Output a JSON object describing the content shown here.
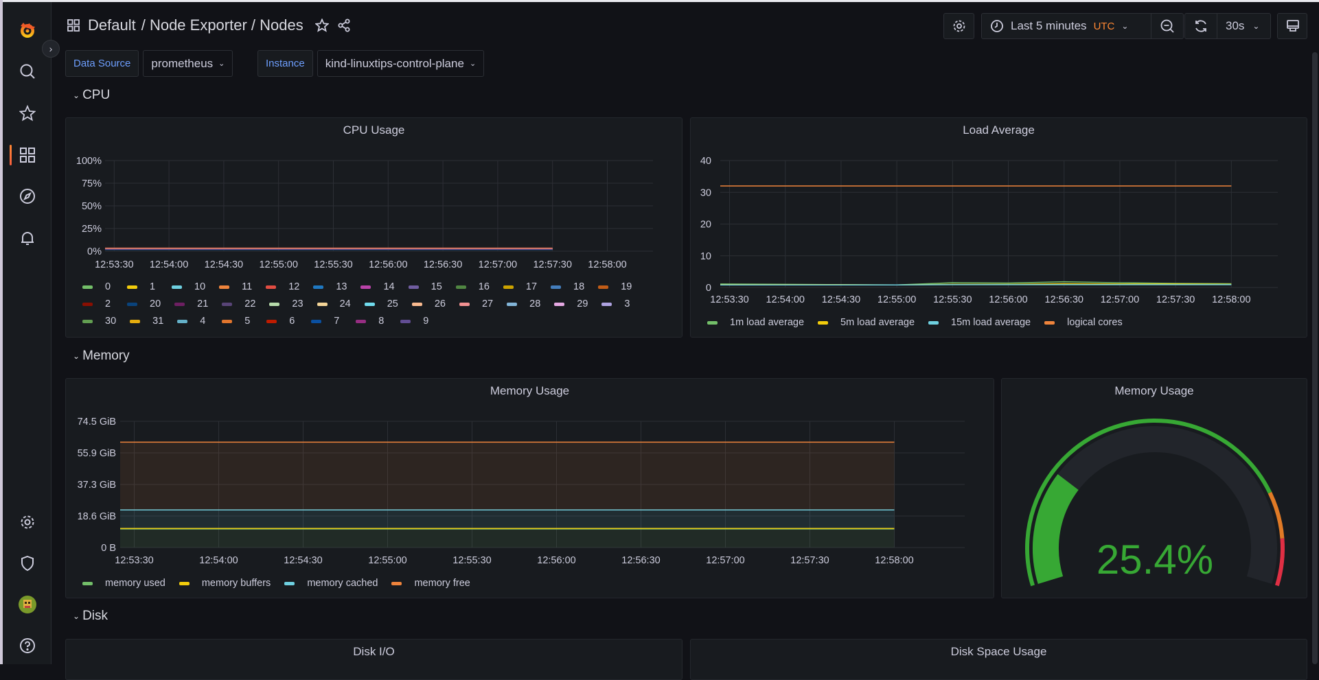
{
  "header": {
    "breadcrumb_folder": "Default",
    "breadcrumb_rest": "/ Node Exporter / Nodes"
  },
  "toolbar": {
    "time_range": "Last 5 minutes",
    "timezone": "UTC",
    "refresh_interval": "30s"
  },
  "variables": [
    {
      "label": "Data Source",
      "value": "prometheus"
    },
    {
      "label": "Instance",
      "value": "kind-linuxtips-control-plane"
    }
  ],
  "rows": {
    "cpu": "CPU",
    "memory": "Memory",
    "disk": "Disk"
  },
  "panels": {
    "cpu_usage": "CPU Usage",
    "load_average": "Load Average",
    "memory_usage": "Memory Usage",
    "memory_gauge": "Memory Usage",
    "disk_io": "Disk I/O",
    "disk_space": "Disk Space Usage"
  },
  "colors": {
    "accent": "#ff8833",
    "timezone": "#ff8833",
    "variable_label": "#6e9fff",
    "gauge_green": "#37a834",
    "gauge_orange": "#e07a26",
    "gauge_red": "#e02f44"
  },
  "chart_data": [
    {
      "type": "line",
      "id": "cpu",
      "xlim": [
        "12:53:25",
        "12:58:25"
      ],
      "xticks": [
        "12:53:30",
        "12:54:00",
        "12:54:30",
        "12:55:00",
        "12:55:30",
        "12:56:00",
        "12:56:30",
        "12:57:00",
        "12:57:30",
        "12:58:00"
      ],
      "yticks": [
        "100%",
        "75%",
        "50%",
        "25%",
        "0%"
      ],
      "ylim": [
        0,
        100
      ],
      "grid": true,
      "legend": "bottom",
      "x": [
        "12:53:25",
        "12:54:30",
        "12:55:30",
        "12:56:30",
        "12:57:30"
      ],
      "series": [
        {
          "name": "0",
          "color": "#73bf69",
          "values": [
            3,
            3,
            3,
            3,
            3
          ]
        },
        {
          "name": "1",
          "color": "#f2cc0c",
          "values": [
            2,
            2,
            2,
            2,
            2
          ]
        },
        {
          "name": "10",
          "color": "#6ed0e0",
          "values": [
            2.5,
            2.5,
            2.5,
            2.5,
            2.5
          ]
        },
        {
          "name": "11",
          "color": "#ef843c",
          "values": [
            2,
            2,
            2,
            2,
            2
          ]
        },
        {
          "name": "12",
          "color": "#e24d42",
          "values": [
            3.5,
            3.5,
            3.5,
            3.5,
            3.5
          ]
        },
        {
          "name": "13",
          "color": "#1f78c1",
          "values": [
            2,
            2,
            2,
            2,
            2
          ]
        },
        {
          "name": "14",
          "color": "#ba43a9",
          "values": [
            2.5,
            2.5,
            2.5,
            2.5,
            2.5
          ]
        },
        {
          "name": "15",
          "color": "#705da0",
          "values": [
            2,
            2,
            2,
            2,
            2
          ]
        },
        {
          "name": "16",
          "color": "#508642",
          "values": [
            1.5,
            1.5,
            1.5,
            1.5,
            1.5
          ]
        },
        {
          "name": "17",
          "color": "#cca300",
          "values": [
            2,
            2,
            2,
            2,
            2
          ]
        },
        {
          "name": "18",
          "color": "#447ebc",
          "values": [
            2,
            2,
            2,
            2,
            2
          ]
        },
        {
          "name": "19",
          "color": "#c15c17",
          "values": [
            2.5,
            2.5,
            2.5,
            2.5,
            2.5
          ]
        },
        {
          "name": "2",
          "color": "#890f02",
          "values": [
            2,
            2,
            2,
            2,
            2
          ]
        },
        {
          "name": "20",
          "color": "#0a437c",
          "values": [
            1.5,
            1.5,
            1.5,
            1.5,
            1.5
          ]
        },
        {
          "name": "21",
          "color": "#6d1f62",
          "values": [
            2,
            2,
            2,
            2,
            2
          ]
        },
        {
          "name": "22",
          "color": "#584477",
          "values": [
            2,
            2,
            2,
            2,
            2
          ]
        },
        {
          "name": "23",
          "color": "#b7dbab",
          "values": [
            2.5,
            2.5,
            2.5,
            2.5,
            2.5
          ]
        },
        {
          "name": "24",
          "color": "#f4d598",
          "values": [
            2,
            2,
            2,
            2,
            2
          ]
        },
        {
          "name": "25",
          "color": "#70dbed",
          "values": [
            2,
            2,
            2,
            2,
            2
          ]
        },
        {
          "name": "26",
          "color": "#f9ba8f",
          "values": [
            3,
            3,
            3,
            3,
            3
          ]
        },
        {
          "name": "27",
          "color": "#f29191",
          "values": [
            2,
            2,
            2,
            2,
            2
          ]
        },
        {
          "name": "28",
          "color": "#82b5d8",
          "values": [
            2,
            2,
            2,
            2,
            2
          ]
        },
        {
          "name": "29",
          "color": "#e5a8e2",
          "values": [
            2.5,
            2.5,
            2.5,
            2.5,
            2.5
          ]
        },
        {
          "name": "3",
          "color": "#aea2e0",
          "values": [
            2,
            2,
            2,
            2,
            2
          ]
        },
        {
          "name": "30",
          "color": "#629e51",
          "values": [
            2,
            2,
            2,
            2,
            2
          ]
        },
        {
          "name": "31",
          "color": "#e5ac0e",
          "values": [
            2,
            2,
            2,
            2,
            2
          ]
        },
        {
          "name": "4",
          "color": "#64b0c8",
          "values": [
            2,
            2,
            2,
            2,
            2
          ]
        },
        {
          "name": "5",
          "color": "#e0752d",
          "values": [
            2.5,
            2.5,
            2.5,
            2.5,
            2.5
          ]
        },
        {
          "name": "6",
          "color": "#bf1b00",
          "values": [
            2,
            2,
            2,
            2,
            2
          ]
        },
        {
          "name": "7",
          "color": "#0a50a1",
          "values": [
            2,
            2,
            2,
            2,
            2
          ]
        },
        {
          "name": "8",
          "color": "#962d82",
          "values": [
            2,
            2,
            2,
            2,
            2
          ]
        },
        {
          "name": "9",
          "color": "#614d93",
          "values": [
            2,
            2,
            2,
            2,
            2
          ]
        }
      ]
    },
    {
      "type": "line",
      "id": "load",
      "xlim": [
        "12:53:25",
        "12:58:25"
      ],
      "xticks": [
        "12:53:30",
        "12:54:00",
        "12:54:30",
        "12:55:00",
        "12:55:30",
        "12:56:00",
        "12:56:30",
        "12:57:00",
        "12:57:30",
        "12:58:00"
      ],
      "yticks": [
        "40",
        "30",
        "20",
        "10",
        "0"
      ],
      "ylim": [
        0,
        40
      ],
      "grid": true,
      "legend": "bottom",
      "x": [
        "12:53:25",
        "12:54:00",
        "12:54:30",
        "12:55:00",
        "12:55:30",
        "12:56:00",
        "12:56:30",
        "12:57:00",
        "12:57:30",
        "12:58:00"
      ],
      "series": [
        {
          "name": "1m load average",
          "color": "#73bf69",
          "values": [
            1.1,
            1.0,
            0.9,
            0.8,
            1.5,
            1.4,
            1.8,
            1.5,
            1.3,
            1.2
          ]
        },
        {
          "name": "5m load average",
          "color": "#f2cc0c",
          "values": [
            0.9,
            0.9,
            0.9,
            0.8,
            1.0,
            1.0,
            1.2,
            1.1,
            1.1,
            1.0
          ]
        },
        {
          "name": "15m load average",
          "color": "#6ed0e0",
          "values": [
            0.8,
            0.8,
            0.8,
            0.8,
            0.9,
            0.9,
            0.9,
            0.9,
            0.9,
            0.9
          ]
        },
        {
          "name": "logical cores",
          "color": "#ef843c",
          "values": [
            32,
            32,
            32,
            32,
            32,
            32,
            32,
            32,
            32,
            32
          ]
        }
      ]
    },
    {
      "type": "area",
      "id": "memory",
      "stacked": true,
      "xlim": [
        "12:53:25",
        "12:58:25"
      ],
      "xticks": [
        "12:53:30",
        "12:54:00",
        "12:54:30",
        "12:55:00",
        "12:55:30",
        "12:56:00",
        "12:56:30",
        "12:57:00",
        "12:57:30",
        "12:58:00"
      ],
      "yticks": [
        "74.5 GiB",
        "55.9 GiB",
        "37.3 GiB",
        "18.6 GiB",
        "0 B"
      ],
      "ylim": [
        0,
        74.5
      ],
      "yunit": "GiB",
      "grid": true,
      "legend": "bottom",
      "x": [
        "12:53:25",
        "12:58:00"
      ],
      "series": [
        {
          "name": "memory used",
          "color": "#73bf69",
          "values": [
            11.0,
            11.0
          ]
        },
        {
          "name": "memory buffers",
          "color": "#f2cc0c",
          "values": [
            0.3,
            0.3
          ]
        },
        {
          "name": "memory cached",
          "color": "#6ed0e0",
          "values": [
            10.9,
            10.9
          ]
        },
        {
          "name": "memory free",
          "color": "#ef843c",
          "values": [
            40.0,
            40.0
          ]
        }
      ]
    },
    {
      "type": "gauge",
      "id": "memory_gauge",
      "value": 25.4,
      "display": "25.4%",
      "min": 0,
      "max": 100,
      "thresholds": [
        {
          "from": 0,
          "color": "#37a834"
        },
        {
          "from": 80,
          "color": "#e07a26"
        },
        {
          "from": 90,
          "color": "#e02f44"
        }
      ]
    }
  ]
}
